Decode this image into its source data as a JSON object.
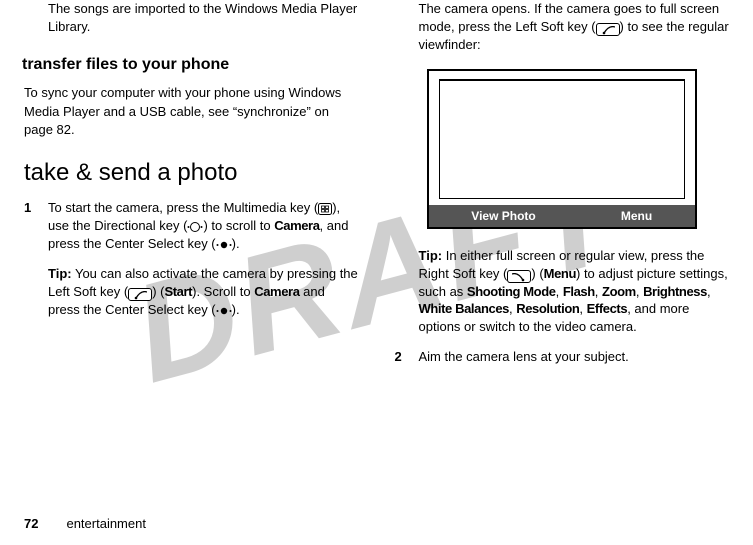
{
  "watermark": "DRAFT",
  "left": {
    "p1": "The songs are imported to the Windows Media Player Library.",
    "h2": "transfer files to your phone",
    "p2": "To sync your computer with your phone using Windows Media Player and a USB cable, see “synchronize” on page 82.",
    "h1": "take & send a photo",
    "step1_num": "1",
    "step1_a": "To start the camera, press the Multimedia key (",
    "step1_b": "), use the Directional key (",
    "step1_c": ") to scroll to ",
    "step1_camera": "Camera",
    "step1_d": ", and press the Center Select key (",
    "step1_e": ").",
    "tip_label": "Tip:",
    "tip_a": " You can also activate the camera by pressing the Left Soft key (",
    "tip_b": ") (",
    "tip_start": "Start",
    "tip_c": "). Scroll to ",
    "tip_camera": "Camera",
    "tip_d": " and press the Center Select key (",
    "tip_e": ")."
  },
  "right": {
    "p1_a": "The camera opens. If the camera goes to full screen mode, press the Left Soft key (",
    "p1_b": ") to see the regular viewfinder:",
    "vf_left": "View Photo",
    "vf_right": "Menu",
    "tip_label": "Tip:",
    "tip_a": " In either full screen or regular view, press the Right Soft key (",
    "tip_b": ") (",
    "tip_menu": "Menu",
    "tip_c": ") to adjust picture settings, such as ",
    "s1": "Shooting Mode",
    "s2": "Flash",
    "s3": "Zoom",
    "s4": "Brightness",
    "s5": "White Balances",
    "s6": "Resolution",
    "s7": "Effects",
    "tip_d": ", and more options or switch to the video camera.",
    "step2_num": "2",
    "step2": "Aim the camera lens at your subject."
  },
  "footer": {
    "page": "72",
    "section": "entertainment"
  }
}
